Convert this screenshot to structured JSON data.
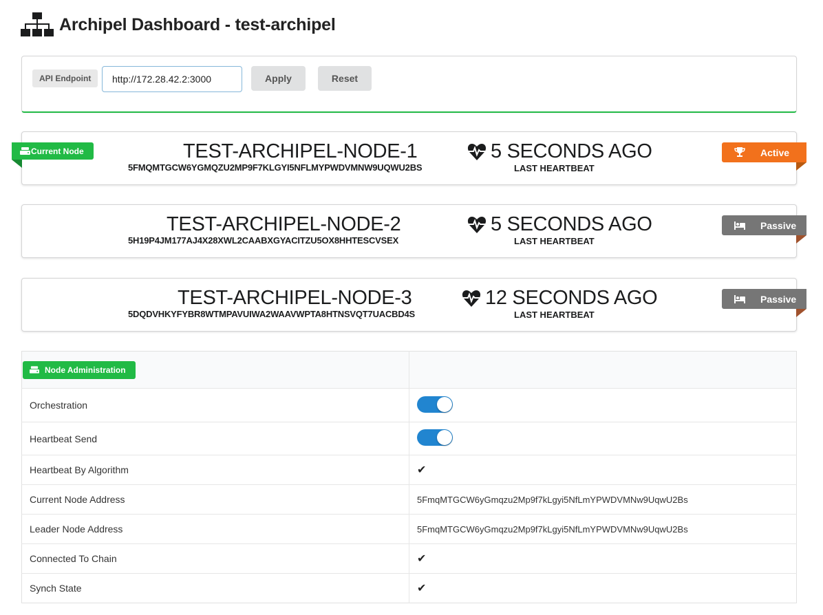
{
  "header": {
    "title": "Archipel Dashboard - test-archipel",
    "logo_icon": "sitemap-icon"
  },
  "api": {
    "label": "API Endpoint",
    "value": "http://172.28.42.2:3000",
    "apply_label": "Apply",
    "reset_label": "Reset"
  },
  "nodes": [
    {
      "name": "TEST-ARCHIPEL-NODE-1",
      "address": "5FMQMTGCW6YGMQZU2MP9F7KLGYI5NFLMYPWDVMNW9UQWU2BS",
      "heartbeat": "5 SECONDS AGO",
      "heartbeat_label": "LAST HEARTBEAT",
      "current_label": "Current Node",
      "status": "Active",
      "status_color": "#f2711c",
      "status_icon": "trophy-icon"
    },
    {
      "name": "TEST-ARCHIPEL-NODE-2",
      "address": "5H19P4JM177AJ4X28XWL2CAABXGYACITZU5OX8HHTESCVSEX",
      "heartbeat": "5 SECONDS AGO",
      "heartbeat_label": "LAST HEARTBEAT",
      "status": "Passive",
      "status_color": "#767676",
      "status_icon": "bed-icon"
    },
    {
      "name": "TEST-ARCHIPEL-NODE-3",
      "address": "5DQDVHKYFYBR8WTMPAVUIWA2WAAVWPTA8HTNSVQT7UACBD4S",
      "heartbeat": "12 SECONDS AGO",
      "heartbeat_label": "LAST HEARTBEAT",
      "status": "Passive",
      "status_color": "#767676",
      "status_icon": "bed-icon"
    }
  ],
  "admin": {
    "title": "Node Administration",
    "rows": [
      {
        "label": "Orchestration",
        "type": "toggle",
        "value": true
      },
      {
        "label": "Heartbeat Send",
        "type": "toggle",
        "value": true
      },
      {
        "label": "Heartbeat By Algorithm",
        "type": "check",
        "value": "✔"
      },
      {
        "label": "Current Node Address",
        "type": "text",
        "value": "5FmqMTGCW6yGmqzu2Mp9f7kLgyi5NfLmYPWDVMNw9UqwU2Bs"
      },
      {
        "label": "Leader Node Address",
        "type": "text",
        "value": "5FmqMTGCW6yGmqzu2Mp9f7kLgyi5NfLmYPWDVMNw9UqwU2Bs"
      },
      {
        "label": "Connected To Chain",
        "type": "check",
        "value": "✔"
      },
      {
        "label": "Synch State",
        "type": "check",
        "value": "✔"
      }
    ]
  },
  "colors": {
    "accent_green": "#21ba45",
    "toggle_blue": "#2185d0",
    "active_orange": "#f2711c",
    "passive_grey": "#767676"
  }
}
